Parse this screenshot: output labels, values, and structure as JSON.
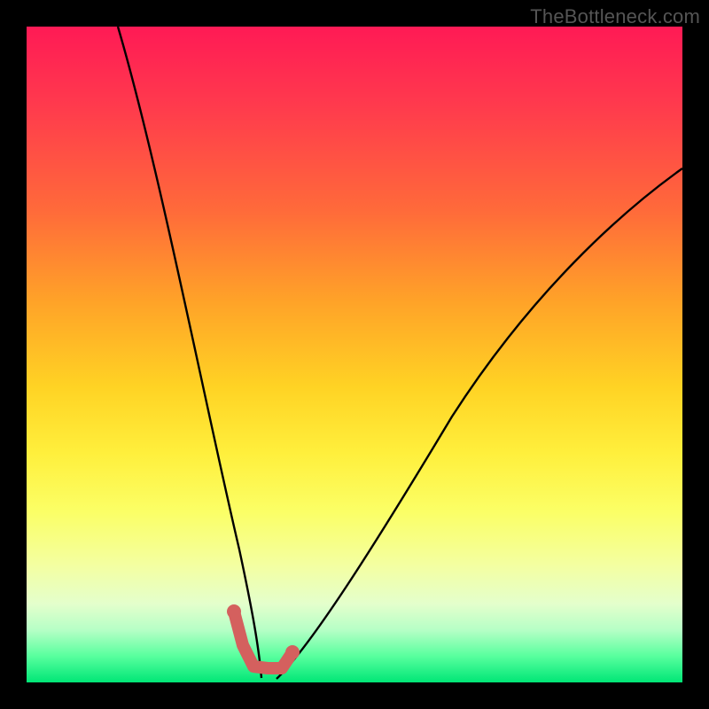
{
  "watermark": "TheBottleneck.com",
  "chart_data": {
    "type": "line",
    "title": "",
    "xlabel": "",
    "ylabel": "",
    "xlim": [
      0,
      100
    ],
    "ylim": [
      0,
      100
    ],
    "grid": false,
    "legend": false,
    "background": "red-yellow-green vertical gradient",
    "annotations": [
      {
        "text": "TheBottleneck.com",
        "position": "top-right",
        "role": "watermark"
      }
    ],
    "series": [
      {
        "name": "left-branch",
        "stroke": "#000000",
        "x": [
          14,
          17,
          20,
          23,
          26,
          28,
          30,
          32,
          33.5,
          35
        ],
        "values": [
          100,
          82,
          65,
          49,
          34,
          24,
          16,
          8,
          3,
          0
        ]
      },
      {
        "name": "right-branch",
        "stroke": "#000000",
        "x": [
          38,
          42,
          48,
          55,
          63,
          72,
          82,
          92,
          100
        ],
        "values": [
          0,
          6,
          16,
          27,
          39,
          51,
          62,
          72,
          79
        ]
      },
      {
        "name": "highlight-marker",
        "stroke": "#d4605e",
        "role": "marker",
        "x": [
          31,
          32,
          33,
          34,
          35,
          36,
          37,
          38,
          39,
          40,
          41
        ],
        "values": [
          11,
          7,
          4,
          2.5,
          2,
          2,
          2,
          2.5,
          3.5,
          5,
          7
        ]
      }
    ]
  }
}
